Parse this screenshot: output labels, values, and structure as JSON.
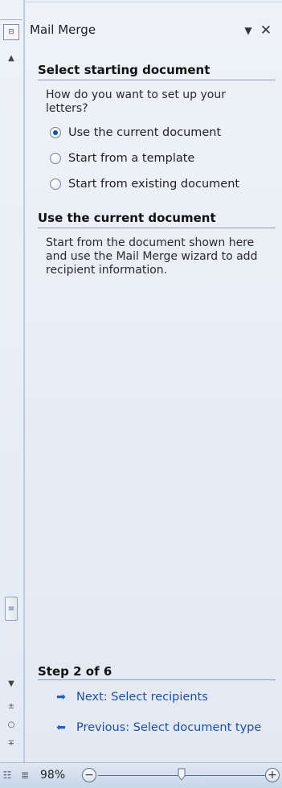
{
  "pane": {
    "title": "Mail Merge",
    "dropdown_icon": "chevron-down-icon",
    "close_icon": "close-icon"
  },
  "section1": {
    "heading": "Select starting document",
    "prompt": "How do you want to set up your letters?",
    "options": [
      {
        "label": "Use the current document",
        "checked": true
      },
      {
        "label": "Start from a template",
        "checked": false
      },
      {
        "label": "Start from existing document",
        "checked": false
      }
    ]
  },
  "section2": {
    "heading": "Use the current document",
    "description": "Start from the document shown here and use the Mail Merge wizard to add recipient information."
  },
  "step": {
    "label": "Step 2 of 6",
    "next": "Next: Select recipients",
    "previous": "Previous: Select document type"
  },
  "status": {
    "zoom": "98%",
    "zoom_level": 0.5
  },
  "colors": {
    "link": "#1f4fa8",
    "accent": "#1b4fa8",
    "pane_bg": "#e8edf5"
  }
}
